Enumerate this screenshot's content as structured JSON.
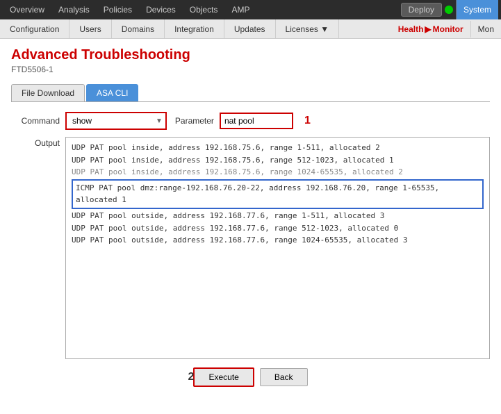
{
  "topNav": {
    "items": [
      {
        "label": "Overview",
        "id": "overview"
      },
      {
        "label": "Analysis",
        "id": "analysis"
      },
      {
        "label": "Policies",
        "id": "policies"
      },
      {
        "label": "Devices",
        "id": "devices"
      },
      {
        "label": "Objects",
        "id": "objects"
      },
      {
        "label": "AMP",
        "id": "amp"
      }
    ],
    "deployLabel": "Deploy",
    "systemLabel": "System"
  },
  "secondNav": {
    "items": [
      {
        "label": "Configuration"
      },
      {
        "label": "Users"
      },
      {
        "label": "Domains"
      },
      {
        "label": "Integration"
      },
      {
        "label": "Updates"
      },
      {
        "label": "Licenses ▼"
      }
    ],
    "healthMonitor": "Health",
    "arrow": "▶",
    "monitor": "Monitor",
    "mon": "Mon"
  },
  "page": {
    "title": "Advanced Troubleshooting",
    "subtitle": "FTD5506-1"
  },
  "tabs": [
    {
      "label": "File Download",
      "id": "file-download",
      "active": false
    },
    {
      "label": "ASA CLI",
      "id": "asa-cli",
      "active": true
    }
  ],
  "command": {
    "label": "Command",
    "selectValue": "show",
    "paramLabel": "Parameter",
    "paramValue": "nat pool",
    "step1": "1"
  },
  "output": {
    "label": "Output",
    "lines": [
      {
        "text": "UDP PAT pool inside, address 192.168.75.6, range 1-511, allocated 2",
        "highlight": false,
        "faded": false
      },
      {
        "text": "UDP PAT pool inside, address 192.168.75.6, range 512-1023, allocated 1",
        "highlight": false,
        "faded": false
      },
      {
        "text": "UDP PAT pool inside, address 192.168.75.6, range 1024-65535, allocated 2",
        "highlight": false,
        "faded": true
      },
      {
        "text": "ICMP PAT pool dmz:range-192.168.76.20-22, address 192.168.76.20, range 1-65535, allocated 1",
        "highlight": true,
        "faded": false
      },
      {
        "text": "UDP PAT pool outside, address 192.168.77.6, range 1-511, allocated 3",
        "highlight": false,
        "faded": false
      },
      {
        "text": "UDP PAT pool outside, address 192.168.77.6, range 512-1023, allocated 0",
        "highlight": false,
        "faded": false
      },
      {
        "text": "UDP PAT pool outside, address 192.168.77.6, range 1024-65535, allocated 3",
        "highlight": false,
        "faded": false
      }
    ]
  },
  "buttons": {
    "step2": "2",
    "execute": "Execute",
    "back": "Back"
  }
}
